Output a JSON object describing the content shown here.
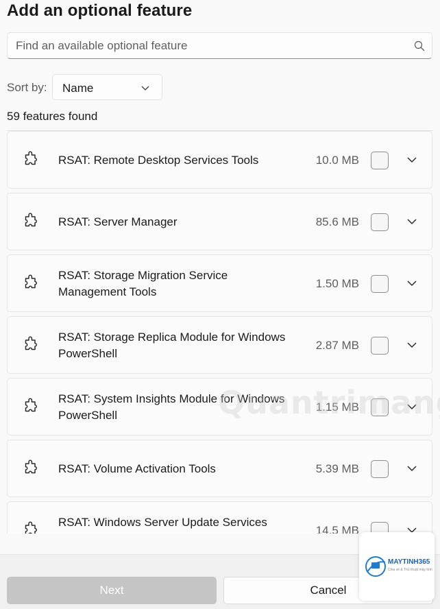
{
  "dialog": {
    "title": "Add an optional feature",
    "search": {
      "placeholder": "Find an available optional feature",
      "value": ""
    },
    "sort": {
      "label": "Sort by:",
      "selected": "Name"
    },
    "count_text": "59 features found"
  },
  "features": [
    {
      "name": "RSAT: Remote Desktop Services Tools",
      "size": "10.0 MB",
      "checked": false
    },
    {
      "name": "RSAT: Server Manager",
      "size": "85.6 MB",
      "checked": false
    },
    {
      "name": "RSAT: Storage Migration Service Management Tools",
      "size": "1.50 MB",
      "checked": false
    },
    {
      "name": "RSAT: Storage Replica Module for Windows PowerShell",
      "size": "2.87 MB",
      "checked": false
    },
    {
      "name": "RSAT: System Insights Module for Windows PowerShell",
      "size": "1.15 MB",
      "checked": false
    },
    {
      "name": "RSAT: Volume Activation Tools",
      "size": "5.39 MB",
      "checked": false
    },
    {
      "name": "RSAT: Windows Server Update Services Tools",
      "size": "14.5 MB",
      "checked": false
    }
  ],
  "footer": {
    "next_label": "Next",
    "cancel_label": "Cancel"
  },
  "watermark": {
    "text": "Quantrimang",
    "logo": "MAYTINH365",
    "logo_sub": "Chia sẻ & Thủ thuật máy tính"
  },
  "colors": {
    "background": "#f9f9f9",
    "next_disabled": "#c5c5c5",
    "text": "#1b1b1b"
  }
}
